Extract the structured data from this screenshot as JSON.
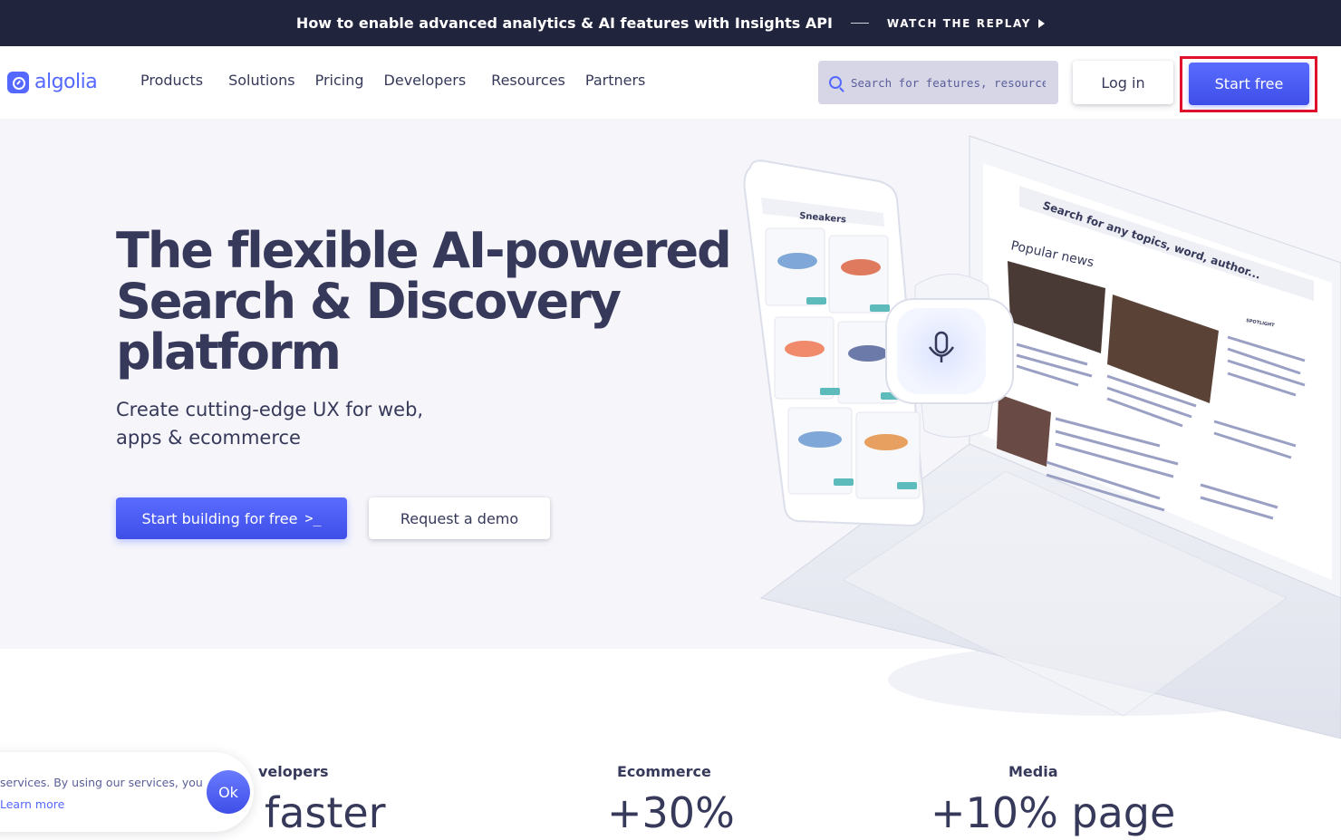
{
  "announcement": {
    "message": "How to enable advanced analytics & AI features with Insights API",
    "cta": "WATCH THE REPLAY"
  },
  "nav": {
    "logo": "algolia",
    "items": [
      "Products",
      "Solutions",
      "Pricing",
      "Developers",
      "Resources",
      "Partners"
    ],
    "search_placeholder": "Search for features, resources...",
    "login": "Log in",
    "start_free": "Start free"
  },
  "hero": {
    "headline_lines": [
      "The flexible AI-powered",
      "Search & Discovery",
      "platform"
    ],
    "subheadline_lines": [
      "Create cutting-edge UX for web,",
      "apps & ecommerce"
    ],
    "primary_cta": "Start building for free",
    "secondary_cta": "Request a demo"
  },
  "illustration": {
    "phone_search": "Sneakers",
    "laptop_search": "Search for any topics, word, author...",
    "laptop_section": "Popular news",
    "laptop_sidebar": "SPOTLIGHT"
  },
  "stats": [
    {
      "label": "velopers",
      "value": "faster"
    },
    {
      "label": "Ecommerce",
      "value": "+30%"
    },
    {
      "label": "Media",
      "value": "+10% page"
    }
  ],
  "cookie": {
    "text": "services. By using our services, you",
    "learn_more": "Learn more",
    "ok": "Ok"
  },
  "colors": {
    "brand": "#5468ff",
    "dark": "#21243d",
    "text": "#36395a",
    "highlight": "#e0102a"
  }
}
